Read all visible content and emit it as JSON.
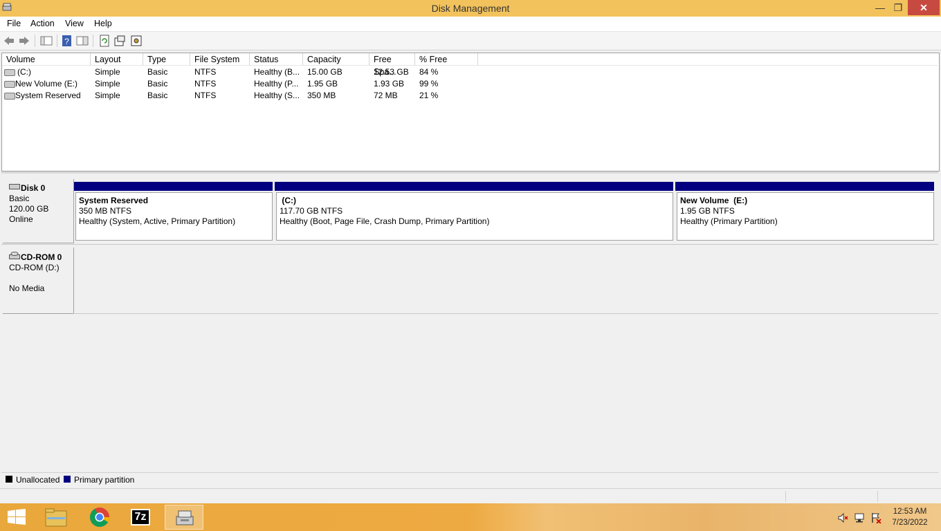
{
  "window": {
    "title": "Disk Management",
    "min_glyph": "—",
    "max_glyph": "❐",
    "close_glyph": "✕"
  },
  "menu": [
    "File",
    "Action",
    "View",
    "Help"
  ],
  "toolbar_icons": [
    "back-arrow-icon",
    "forward-arrow-icon",
    "console-tree-icon",
    "help-icon",
    "show-hide-icon",
    "refresh-icon",
    "properties-icon",
    "disk-settings-icon"
  ],
  "volume_table": {
    "columns": [
      "Volume",
      "Layout",
      "Type",
      "File System",
      "Status",
      "Capacity",
      "Free Spa...",
      "% Free"
    ],
    "rows": [
      [
        "(C:)",
        "Simple",
        "Basic",
        "NTFS",
        "Healthy (B...",
        "15.00 GB",
        "12.53 GB",
        "84 %"
      ],
      [
        "New Volume (E:)",
        "Simple",
        "Basic",
        "NTFS",
        "Healthy (P...",
        "1.95 GB",
        "1.93 GB",
        "99 %"
      ],
      [
        "System Reserved",
        "Simple",
        "Basic",
        "NTFS",
        "Healthy (S...",
        "350 MB",
        "72 MB",
        "21 %"
      ]
    ]
  },
  "disks": [
    {
      "name": "Disk 0",
      "type": "Basic",
      "size": "120.00 GB",
      "status": "Online",
      "partitions": [
        {
          "name": "System Reserved",
          "size": "350 MB NTFS",
          "status": "Healthy (System, Active, Primary Partition)"
        },
        {
          "name": " (C:)",
          "size": "117.70 GB NTFS",
          "status": "Healthy (Boot, Page File, Crash Dump, Primary Partition)"
        },
        {
          "name": "New Volume  (E:)",
          "size": "1.95 GB NTFS",
          "status": "Healthy (Primary Partition)"
        }
      ]
    },
    {
      "name": "CD-ROM 0",
      "drive": "CD-ROM (D:)",
      "status": "No Media"
    }
  ],
  "legend": [
    {
      "label": "Unallocated",
      "color": "#000000"
    },
    {
      "label": "Primary partition",
      "color": "#000080"
    }
  ],
  "taskbar": {
    "apps": [
      "file-explorer-icon",
      "chrome-icon",
      "7zip-icon",
      "disk-management-icon"
    ],
    "sevenzip_label": "7z",
    "time": "12:53 AM",
    "date": "7/23/2022"
  },
  "colors": {
    "titlebar": "#f2c25c",
    "close": "#c74a40",
    "partition_bar": "#000080"
  }
}
